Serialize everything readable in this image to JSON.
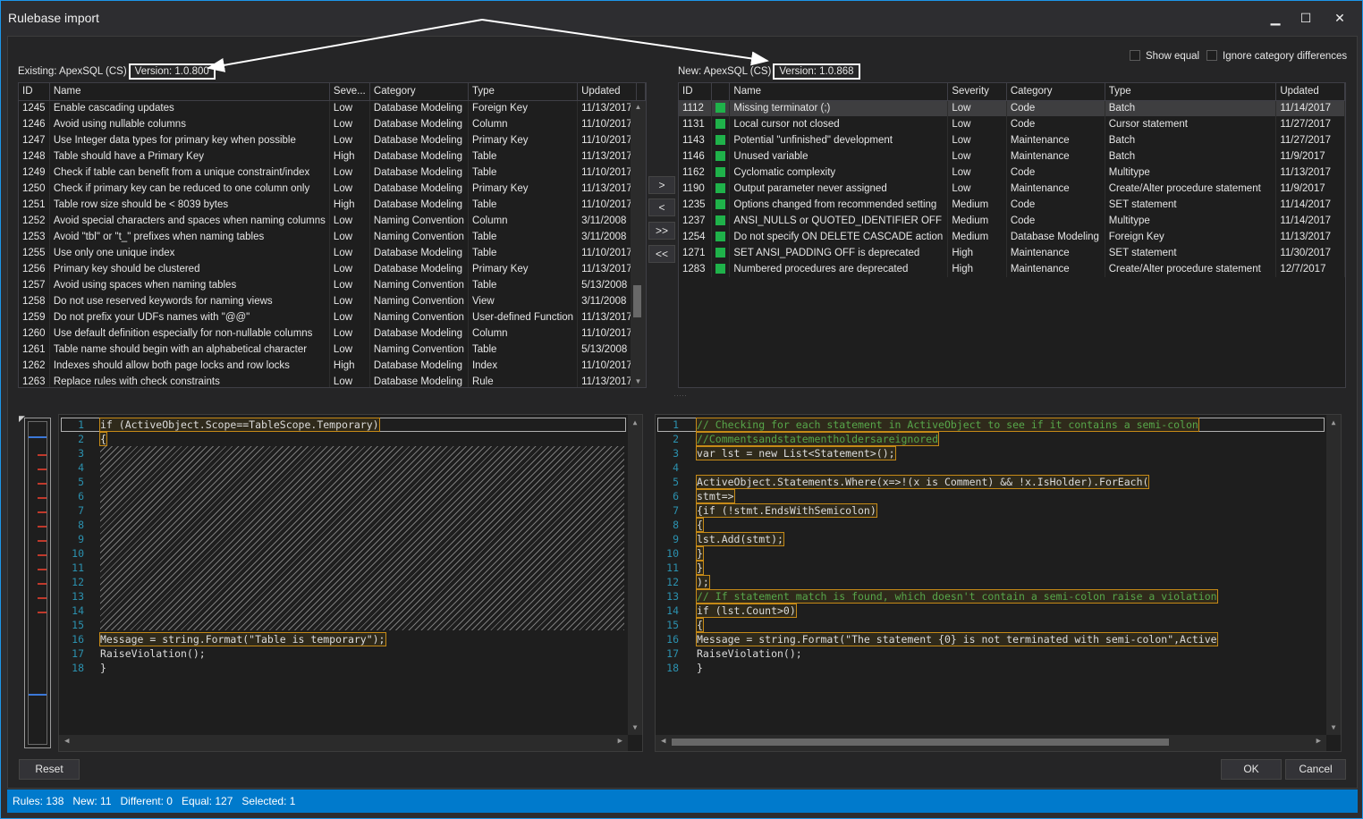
{
  "window": {
    "title": "Rulebase import",
    "minimize": "▁",
    "maximize": "☐",
    "close": "✕"
  },
  "options": {
    "show_equal": "Show equal",
    "ignore_category": "Ignore category differences"
  },
  "existing": {
    "label": "Existing: ApexSQL (CS)",
    "version": "Version: 1.0.800",
    "columns": [
      "ID",
      "Name",
      "Seve...",
      "Category",
      "Type",
      "Updated"
    ],
    "rows": [
      [
        "1245",
        "Enable cascading updates",
        "Low",
        "Database Modeling",
        "Foreign Key",
        "11/13/2017"
      ],
      [
        "1246",
        "Avoid using nullable columns",
        "Low",
        "Database Modeling",
        "Column",
        "11/10/2017"
      ],
      [
        "1247",
        "Use Integer data types for primary key when possible",
        "Low",
        "Database Modeling",
        "Primary Key",
        "11/10/2017"
      ],
      [
        "1248",
        "Table should have a Primary Key",
        "High",
        "Database Modeling",
        "Table",
        "11/13/2017"
      ],
      [
        "1249",
        "Check if table can benefit from a unique constraint/index",
        "Low",
        "Database Modeling",
        "Table",
        "11/10/2017"
      ],
      [
        "1250",
        "Check if primary key can be reduced to one column only",
        "Low",
        "Database Modeling",
        "Primary Key",
        "11/13/2017"
      ],
      [
        "1251",
        "Table row size should be < 8039 bytes",
        "High",
        "Database Modeling",
        "Table",
        "11/10/2017"
      ],
      [
        "1252",
        "Avoid special characters and spaces when naming columns",
        "Low",
        "Naming Convention",
        "Column",
        "3/11/2008"
      ],
      [
        "1253",
        "Avoid \"tbl\" or \"t_\" prefixes when naming tables",
        "Low",
        "Naming Convention",
        "Table",
        "3/11/2008"
      ],
      [
        "1255",
        "Use only one unique index",
        "Low",
        "Database Modeling",
        "Table",
        "11/10/2017"
      ],
      [
        "1256",
        "Primary key should be clustered",
        "Low",
        "Database Modeling",
        "Primary Key",
        "11/13/2017"
      ],
      [
        "1257",
        "Avoid using spaces when naming tables",
        "Low",
        "Naming Convention",
        "Table",
        "5/13/2008"
      ],
      [
        "1258",
        "Do not use reserved keywords for naming views",
        "Low",
        "Naming Convention",
        "View",
        "3/11/2008"
      ],
      [
        "1259",
        "Do not prefix your UDFs names with \"@@\"",
        "Low",
        "Naming Convention",
        "User-defined Function",
        "11/13/2017"
      ],
      [
        "1260",
        "Use default definition especially for non-nullable columns",
        "Low",
        "Database Modeling",
        "Column",
        "11/10/2017"
      ],
      [
        "1261",
        "Table name should begin with an alphabetical character",
        "Low",
        "Naming Convention",
        "Table",
        "5/13/2008"
      ],
      [
        "1262",
        "Indexes should allow both page locks and row locks",
        "High",
        "Database Modeling",
        "Index",
        "11/10/2017"
      ],
      [
        "1263",
        "Replace rules with check constraints",
        "Low",
        "Database Modeling",
        "Rule",
        "11/13/2017"
      ]
    ]
  },
  "new": {
    "label": "New: ApexSQL (CS)",
    "version": "Version: 1.0.868",
    "columns": [
      "ID",
      "",
      "Name",
      "Severity",
      "Category",
      "Type",
      "Updated"
    ],
    "rows": [
      [
        "1112",
        "Missing terminator (;)",
        "Low",
        "Code",
        "Batch",
        "11/14/2017"
      ],
      [
        "1131",
        "Local cursor not closed",
        "Low",
        "Code",
        "Cursor statement",
        "11/27/2017"
      ],
      [
        "1143",
        "Potential \"unfinished\" development",
        "Low",
        "Maintenance",
        "Batch",
        "11/27/2017"
      ],
      [
        "1146",
        "Unused variable",
        "Low",
        "Maintenance",
        "Batch",
        "11/9/2017"
      ],
      [
        "1162",
        "Cyclomatic complexity",
        "Low",
        "Code",
        "Multitype",
        "11/13/2017"
      ],
      [
        "1190",
        "Output parameter never assigned",
        "Low",
        "Maintenance",
        "Create/Alter procedure statement",
        "11/9/2017"
      ],
      [
        "1235",
        "Options changed from recommended setting",
        "Medium",
        "Code",
        "SET statement",
        "11/14/2017"
      ],
      [
        "1237",
        "ANSI_NULLS or QUOTED_IDENTIFIER  OFF",
        "Medium",
        "Code",
        "Multitype",
        "11/14/2017"
      ],
      [
        "1254",
        "Do not specify ON DELETE CASCADE action",
        "Medium",
        "Database Modeling",
        "Foreign Key",
        "11/13/2017"
      ],
      [
        "1271",
        "SET ANSI_PADDING OFF is deprecated",
        "High",
        "Maintenance",
        "SET statement",
        "11/30/2017"
      ],
      [
        "1283",
        "Numbered procedures are deprecated",
        "High",
        "Maintenance",
        "Create/Alter procedure statement",
        "12/7/2017"
      ]
    ],
    "selected_index": 0,
    "status_color": "#1fb24a"
  },
  "move_buttons": [
    ">",
    "<",
    ">>",
    "<<"
  ],
  "left_code": {
    "line_numbers": [
      "1",
      "2",
      "3",
      "4",
      "5",
      "6",
      "7",
      "8",
      "9",
      "10",
      "11",
      "12",
      "13",
      "14",
      "15",
      "16",
      "17",
      "18"
    ],
    "line1": "if (ActiveObject.Scope==TableScope.Temporary)",
    "line2": "{",
    "line16": "    Message = string.Format(\"Table is temporary\");",
    "line17": "    RaiseViolation();",
    "line18": "}"
  },
  "right_code": {
    "lines": [
      "// Checking for each statement in ActiveObject to see if it contains a semi-colon",
      "//Commentsandstatementholdersareignored",
      "var lst = new List<Statement>();",
      "",
      "ActiveObject.Statements.Where(x=>!(x is Comment) && !x.IsHolder).ForEach(",
      "    stmt=>",
      "        {if (!stmt.EndsWithSemicolon)",
      "        {",
      "                lst.Add(stmt);",
      "        }",
      "        }",
      ");",
      "// If statement match is found, which doesn't contain a semi-colon raise a violation",
      "if (lst.Count>0)",
      "{",
      "    Message = string.Format(\"The statement {0} is not terminated with semi-colon\",Active",
      "    RaiseViolation();",
      "}"
    ]
  },
  "buttons": {
    "reset": "Reset",
    "ok": "OK",
    "cancel": "Cancel"
  },
  "status": "Rules: 138   New: 11   Different: 0   Equal: 127   Selected: 1"
}
